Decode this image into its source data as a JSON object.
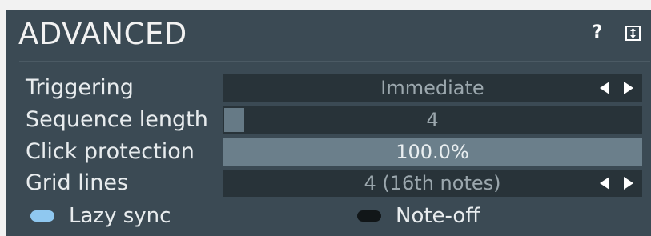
{
  "panel": {
    "title": "ADVANCED",
    "help_icon": "question-mark-icon",
    "menu_icon": "panel-menu-icon"
  },
  "rows": {
    "triggering": {
      "label": "Triggering",
      "value": "Immediate"
    },
    "sequence_length": {
      "label": "Sequence length",
      "value": "4",
      "fill_fraction": 0.05
    },
    "click_protection": {
      "label": "Click protection",
      "value": "100.0%",
      "fill_fraction": 1.0
    },
    "grid_lines": {
      "label": "Grid lines",
      "value": "4 (16th notes)"
    }
  },
  "toggles": {
    "lazy_sync": {
      "label": "Lazy sync",
      "on": true
    },
    "note_off": {
      "label": "Note-off",
      "on": false
    }
  },
  "colors": {
    "panel_bg": "#3b4a54",
    "field_bg": "#283339",
    "toggle_on": "#8fc8f0",
    "toggle_off": "#111618"
  }
}
